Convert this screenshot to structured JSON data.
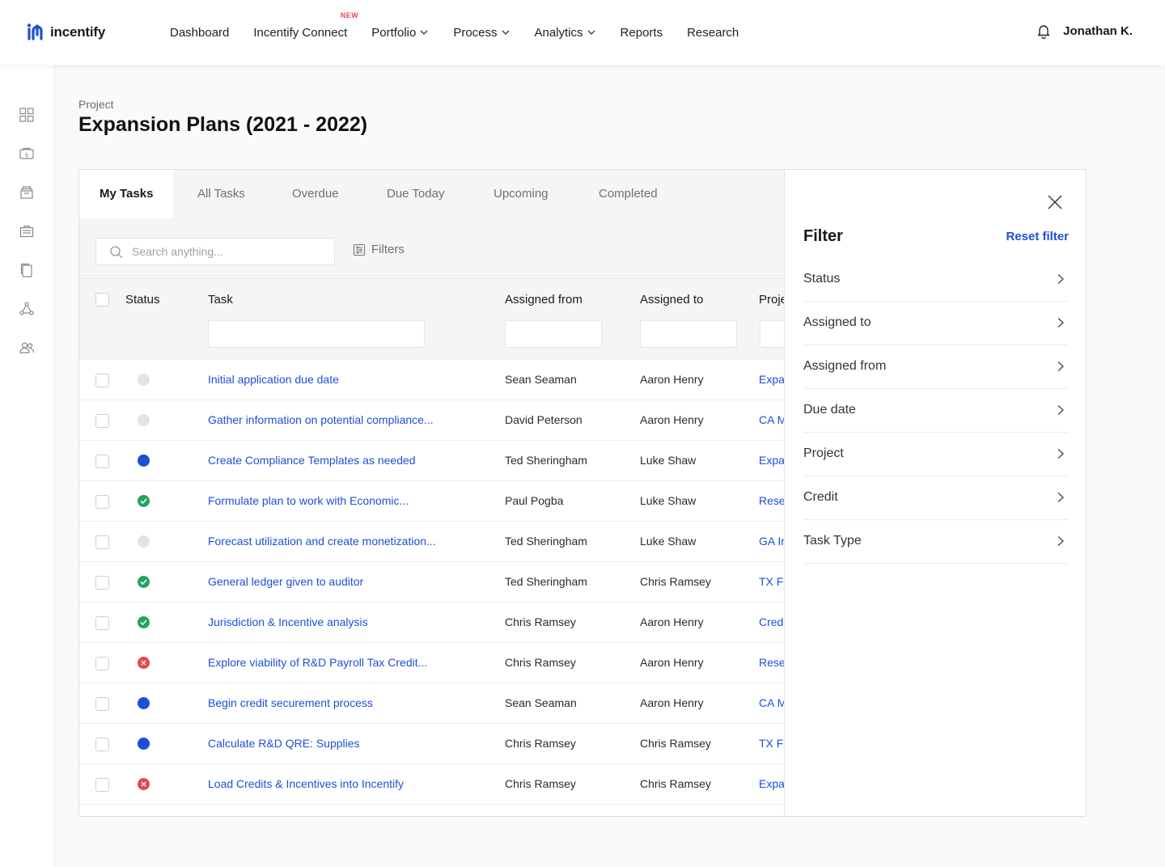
{
  "brand": {
    "name": "incentify",
    "color": "#1e4fd6"
  },
  "nav": {
    "items": [
      {
        "label": "Dashboard",
        "dropdown": false
      },
      {
        "label": "Incentify Connect",
        "dropdown": false,
        "badge": "NEW"
      },
      {
        "label": "Portfolio",
        "dropdown": true
      },
      {
        "label": "Process",
        "dropdown": true
      },
      {
        "label": "Analytics",
        "dropdown": true
      },
      {
        "label": "Reports",
        "dropdown": false
      },
      {
        "label": "Research",
        "dropdown": false
      }
    ]
  },
  "user": {
    "name": "Jonathan K."
  },
  "sidebar": {
    "icons": [
      "grid-icon",
      "money-icon",
      "archive-icon",
      "briefcase-icon",
      "documents-icon",
      "network-icon",
      "users-icon"
    ]
  },
  "header": {
    "breadcrumb": "Project",
    "title": "Expansion Plans (2021 - 2022)"
  },
  "tabs": [
    {
      "label": "My Tasks",
      "active": true
    },
    {
      "label": "All Tasks",
      "active": false
    },
    {
      "label": "Overdue",
      "active": false
    },
    {
      "label": "Due Today",
      "active": false
    },
    {
      "label": "Upcoming",
      "active": false
    },
    {
      "label": "Completed",
      "active": false
    }
  ],
  "search": {
    "placeholder": "Search anything...",
    "value": ""
  },
  "filters_label": "Filters",
  "table": {
    "columns": {
      "status": "Status",
      "task": "Task",
      "from": "Assigned from",
      "to": "Assigned to",
      "project": "Project"
    },
    "rows": [
      {
        "status": "todo",
        "task": "Initial application due date",
        "from": "Sean Seaman",
        "to": "Aaron Henry",
        "project": "Expansion Plans"
      },
      {
        "status": "todo",
        "task": "Gather information on potential compliance...",
        "from": "David Peterson",
        "to": "Aaron Henry",
        "project": "CA M"
      },
      {
        "status": "progress",
        "task": "Create Compliance Templates as needed",
        "from": "Ted Sheringham",
        "to": "Luke Shaw",
        "project": "Expansion Plans"
      },
      {
        "status": "done",
        "task": "Formulate plan to work with Economic...",
        "from": "Paul Pogba",
        "to": "Luke Shaw",
        "project": "Research"
      },
      {
        "status": "todo",
        "task": "Forecast utilization and create monetization...",
        "from": "Ted Sheringham",
        "to": "Luke Shaw",
        "project": "GA In"
      },
      {
        "status": "done",
        "task": "General ledger given to auditor",
        "from": "Ted Sheringham",
        "to": "Chris Ramsey",
        "project": "TX F"
      },
      {
        "status": "done",
        "task": "Jurisdiction & Incentive analysis",
        "from": "Chris Ramsey",
        "to": "Aaron Henry",
        "project": "Credits"
      },
      {
        "status": "failed",
        "task": "Explore viability of R&D Payroll Tax Credit...",
        "from": "Chris Ramsey",
        "to": "Aaron Henry",
        "project": "Research"
      },
      {
        "status": "progress",
        "task": "Begin credit securement process",
        "from": "Sean Seaman",
        "to": "Aaron Henry",
        "project": "CA M"
      },
      {
        "status": "progress",
        "task": "Calculate R&D QRE: Supplies",
        "from": "Chris Ramsey",
        "to": "Chris Ramsey",
        "project": "TX F"
      },
      {
        "status": "failed",
        "task": "Load Credits & Incentives into Incentify",
        "from": "Chris Ramsey",
        "to": "Chris Ramsey",
        "project": "Expansion Plans"
      }
    ]
  },
  "filter_panel": {
    "title": "Filter",
    "reset_label": "Reset filter",
    "items": [
      "Status",
      "Assigned to",
      "Assigned from",
      "Due date",
      "Project",
      "Credit",
      "Task Type"
    ]
  },
  "colors": {
    "accent": "#1e4fd6",
    "status_todo": "#dfe4ea",
    "status_progress": "#1d4ed8",
    "status_done": "#22a55b",
    "status_failed": "#e5484d",
    "badge_new": "#e5484d"
  }
}
